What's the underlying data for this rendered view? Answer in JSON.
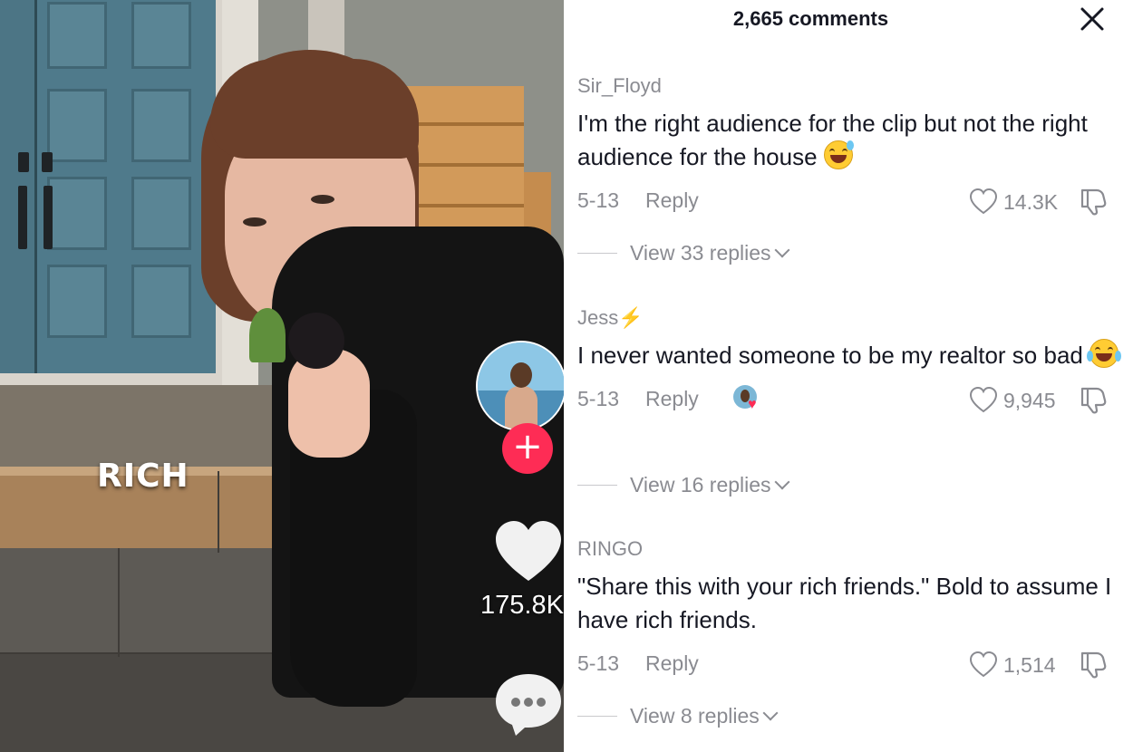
{
  "video": {
    "overlay_text": "RICH",
    "like_count": "175.8K",
    "follow_symbol": "+"
  },
  "comments_panel": {
    "title": "2,665 comments",
    "close_symbol": "✕",
    "comments": [
      {
        "username": "Sir_Floyd",
        "text": "I'm the right audience for the clip but not the right audience for the house",
        "emoji": "grinning-face-with-sweat",
        "date": "5-13",
        "reply_label": "Reply",
        "likes": "14.3K",
        "view_replies": "View 33 replies"
      },
      {
        "username": "Jess",
        "username_badge": "⚡",
        "text": "I never wanted someone to be my realtor so bad",
        "emoji": "face-with-tears-of-joy",
        "date": "5-13",
        "reply_label": "Reply",
        "likes": "9,945",
        "view_replies": "View 16 replies"
      },
      {
        "username": "RINGO",
        "text": "\"Share this with your rich friends.\" Bold to assume I have rich friends.",
        "date": "5-13",
        "reply_label": "Reply",
        "likes": "1,514",
        "view_replies": "View 8 replies"
      }
    ]
  },
  "colors": {
    "accent": "#fe2c55",
    "text_primary": "#161823",
    "text_secondary": "#8a8b91"
  }
}
